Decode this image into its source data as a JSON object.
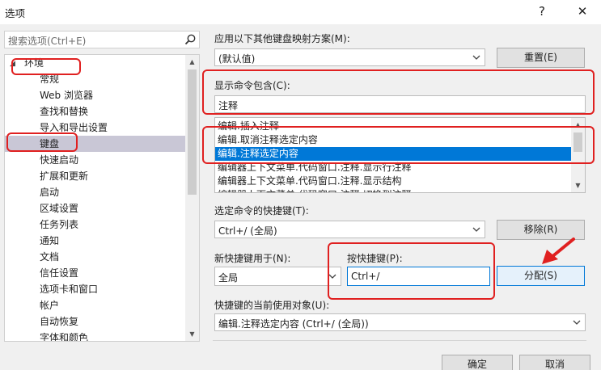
{
  "window": {
    "title": "选项",
    "help_glyph": "?",
    "close_glyph": "✕"
  },
  "search": {
    "placeholder": "搜索选项(Ctrl+E)"
  },
  "tree": {
    "items": [
      {
        "label": "环境",
        "expanded": true,
        "level": 0
      },
      {
        "label": "常规",
        "level": 1
      },
      {
        "label": "Web 浏览器",
        "level": 1
      },
      {
        "label": "查找和替换",
        "level": 1
      },
      {
        "label": "导入和导出设置",
        "level": 1
      },
      {
        "label": "键盘",
        "level": 1,
        "selected": true
      },
      {
        "label": "快速启动",
        "level": 1
      },
      {
        "label": "扩展和更新",
        "level": 1
      },
      {
        "label": "启动",
        "level": 1
      },
      {
        "label": "区域设置",
        "level": 1
      },
      {
        "label": "任务列表",
        "level": 1
      },
      {
        "label": "通知",
        "level": 1
      },
      {
        "label": "文档",
        "level": 1
      },
      {
        "label": "信任设置",
        "level": 1
      },
      {
        "label": "选项卡和窗口",
        "level": 1
      },
      {
        "label": "帐户",
        "level": 1
      },
      {
        "label": "自动恢复",
        "level": 1
      },
      {
        "label": "字体和颜色",
        "level": 1
      }
    ]
  },
  "mapping": {
    "label": "应用以下其他键盘映射方案(M):",
    "value": "(默认值)",
    "reset_button": "重置(E)"
  },
  "show_commands": {
    "label": "显示命令包含(C):",
    "value": "注释"
  },
  "commands": {
    "items": [
      "编辑.插入注释",
      "编辑.取消注释选定内容",
      "编辑.注释选定内容",
      "编辑器上下文菜单.代码窗口.注释.显示行注释",
      "编辑器上下文菜单.代码窗口.注释.显示结构",
      "编辑器上下文菜单.代码窗口.注释.切换到注释"
    ],
    "selected_index": 2
  },
  "selected_shortcut": {
    "label": "选定命令的快捷键(T):",
    "value": "Ctrl+/ (全局)",
    "remove_button": "移除(R)"
  },
  "new_shortcut": {
    "label": "新快捷键用于(N):",
    "value": "全局"
  },
  "press_shortcut": {
    "label": "按快捷键(P):",
    "value": "Ctrl+/"
  },
  "assign_button": "分配(S)",
  "currently_used": {
    "label": "快捷键的当前使用对象(U):",
    "value": "编辑.注释选定内容 (Ctrl+/ (全局))"
  },
  "footer": {
    "ok": "确定",
    "cancel": "取消"
  },
  "colors": {
    "highlight": "#0078d7",
    "annotation_red": "#e02020",
    "tree_selection": "#c9c7d6"
  },
  "icons": [
    "search-icon",
    "chevron-down-icon",
    "help-icon",
    "close-icon",
    "arrow-annotation-icon"
  ]
}
